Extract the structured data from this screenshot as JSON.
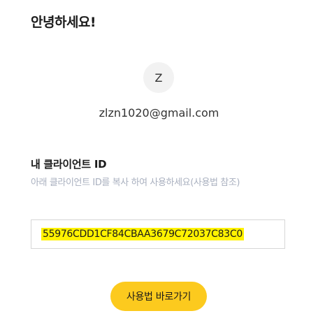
{
  "greeting": "안녕하세요!",
  "user": {
    "avatar_initial": "Z",
    "email": "zlzn1020@gmail.com"
  },
  "client_id_section": {
    "title": "내 클라이언트 ID",
    "hint": "아래 클라이언트 ID를 복사 하여 사용하세요(사용법 참조)",
    "client_id": "55976CDD1CF84CBAA3679C72037C83C0"
  },
  "actions": {
    "go_usage_label": "사용법 바로가기"
  },
  "colors": {
    "button_bg": "#fcca1e",
    "highlight": "#fff200",
    "hint_text": "#a9b0bf"
  }
}
